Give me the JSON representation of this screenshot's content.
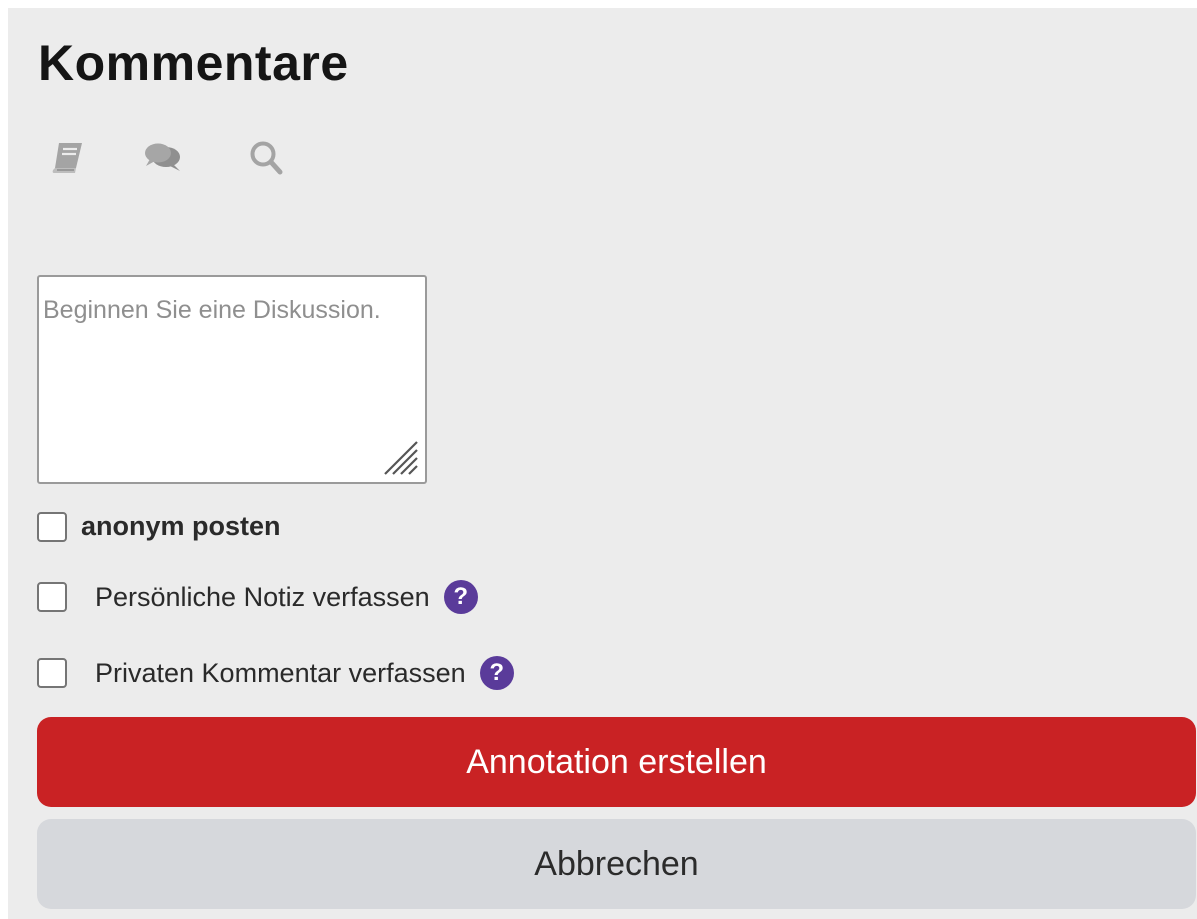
{
  "header": {
    "title": "Kommentare"
  },
  "toolbar": {
    "icons": [
      "book-icon",
      "comments-icon",
      "search-icon"
    ],
    "icon_color": "#a4a4a4"
  },
  "comment_box": {
    "placeholder": "Beginnen Sie eine Diskussion.",
    "value": ""
  },
  "options": {
    "anonymous": {
      "label": "anonym posten",
      "checked": false
    },
    "personal_note": {
      "label": "Persönliche Notiz verfassen",
      "checked": false,
      "help": "?"
    },
    "private_comment": {
      "label": "Privaten Kommentar verfassen",
      "checked": false,
      "help": "?"
    }
  },
  "actions": {
    "submit_label": "Annotation erstellen",
    "cancel_label": "Abbrechen"
  },
  "colors": {
    "background": "#ececec",
    "primary": "#c92224",
    "secondary": "#d6d8dc",
    "help_badge": "#5a3b9a"
  }
}
